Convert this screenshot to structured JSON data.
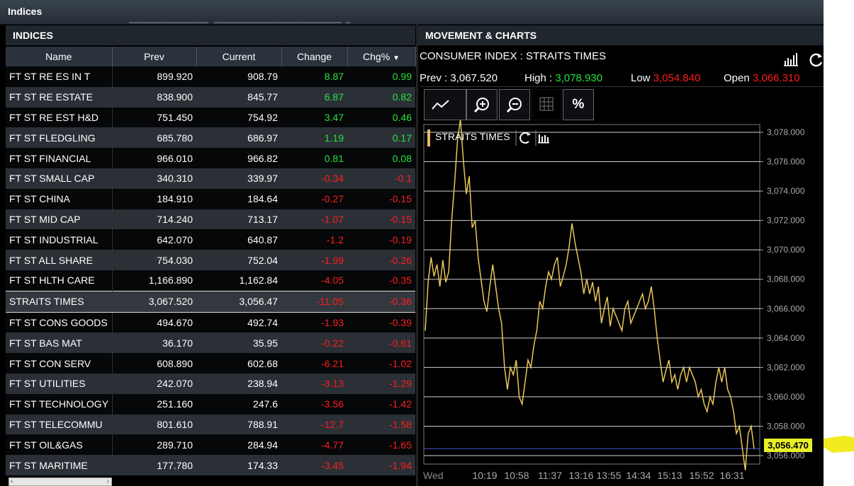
{
  "window": {
    "title": "Indices"
  },
  "left_panel": {
    "title": "INDICES",
    "columns": [
      "Name",
      "Prev",
      "Current",
      "Change",
      "Chg%"
    ],
    "rows": [
      {
        "name": "FT ST RE ES IN T",
        "prev": "899.920",
        "current": "908.79",
        "change": "8.87",
        "chg": "0.99",
        "dir": "pos"
      },
      {
        "name": "FT ST RE ESTATE",
        "prev": "838.900",
        "current": "845.77",
        "change": "6.87",
        "chg": "0.82",
        "dir": "pos"
      },
      {
        "name": "FT ST RE EST H&D",
        "prev": "751.450",
        "current": "754.92",
        "change": "3.47",
        "chg": "0.46",
        "dir": "pos"
      },
      {
        "name": "FT ST FLEDGLING",
        "prev": "685.780",
        "current": "686.97",
        "change": "1.19",
        "chg": "0.17",
        "dir": "pos"
      },
      {
        "name": "FT ST FINANCIAL",
        "prev": "966.010",
        "current": "966.82",
        "change": "0.81",
        "chg": "0.08",
        "dir": "pos"
      },
      {
        "name": "FT ST SMALL CAP",
        "prev": "340.310",
        "current": "339.97",
        "change": "-0.34",
        "chg": "-0.1",
        "dir": "neg"
      },
      {
        "name": "FT ST CHINA",
        "prev": "184.910",
        "current": "184.64",
        "change": "-0.27",
        "chg": "-0.15",
        "dir": "neg"
      },
      {
        "name": "FT ST MID CAP",
        "prev": "714.240",
        "current": "713.17",
        "change": "-1.07",
        "chg": "-0.15",
        "dir": "neg"
      },
      {
        "name": "FT ST INDUSTRIAL",
        "prev": "642.070",
        "current": "640.87",
        "change": "-1.2",
        "chg": "-0.19",
        "dir": "neg"
      },
      {
        "name": "FT ST ALL SHARE",
        "prev": "754.030",
        "current": "752.04",
        "change": "-1.99",
        "chg": "-0.26",
        "dir": "neg"
      },
      {
        "name": "FT ST HLTH CARE",
        "prev": "1,166.890",
        "current": "1,162.84",
        "change": "-4.05",
        "chg": "-0.35",
        "dir": "neg"
      },
      {
        "name": "STRAITS TIMES",
        "prev": "3,067.520",
        "current": "3,056.47",
        "change": "-11.05",
        "chg": "-0.36",
        "dir": "neg",
        "selected": true
      },
      {
        "name": "FT ST CONS GOODS",
        "prev": "494.670",
        "current": "492.74",
        "change": "-1.93",
        "chg": "-0.39",
        "dir": "neg"
      },
      {
        "name": "FT ST BAS MAT",
        "prev": "36.170",
        "current": "35.95",
        "change": "-0.22",
        "chg": "-0.61",
        "dir": "neg"
      },
      {
        "name": "FT ST CON SERV",
        "prev": "608.890",
        "current": "602.68",
        "change": "-6.21",
        "chg": "-1.02",
        "dir": "neg"
      },
      {
        "name": "FT ST UTILITIES",
        "prev": "242.070",
        "current": "238.94",
        "change": "-3.13",
        "chg": "-1.29",
        "dir": "neg"
      },
      {
        "name": "FT ST TECHNOLOGY",
        "prev": "251.160",
        "current": "247.6",
        "change": "-3.56",
        "chg": "-1.42",
        "dir": "neg"
      },
      {
        "name": "FT ST TELECOMMU",
        "prev": "801.610",
        "current": "788.91",
        "change": "-12.7",
        "chg": "-1.58",
        "dir": "neg"
      },
      {
        "name": "FT ST OIL&GAS",
        "prev": "289.710",
        "current": "284.94",
        "change": "-4.77",
        "chg": "-1.65",
        "dir": "neg"
      },
      {
        "name": "FT ST MARITIME",
        "prev": "177.780",
        "current": "174.33",
        "change": "-3.45",
        "chg": "-1.94",
        "dir": "neg"
      }
    ]
  },
  "right_panel": {
    "title": "MOVEMENT & CHARTS",
    "chart_title": "CONSUMER INDEX : STRAITS TIMES",
    "stats": {
      "prev_label": "Prev :",
      "prev_value": "3,067.520",
      "high_label": "High :",
      "high_value": "3,078.930",
      "low_label": "Low",
      "low_value": "3,054.840",
      "open_label": "Open",
      "open_value": "3,066.310"
    },
    "tools": {
      "zoom_in": "zoom-in",
      "zoom_out": "zoom-out",
      "percent_label": "%"
    },
    "legend_label": "STRAITS TIMES",
    "current_price": "3,056.470",
    "x_start_label": "Wed",
    "colors": {
      "line": "#e8c85a",
      "positive": "#27e23b",
      "negative": "#ff1c1c",
      "price_tag": "#e7ef28"
    }
  },
  "chart_data": {
    "type": "line",
    "series": [
      {
        "name": "STRAITS TIMES",
        "values": [
          3064.5,
          3067.8,
          3069.5,
          3068.2,
          3069.0,
          3067.5,
          3069.3,
          3067.8,
          3068.5,
          3072.0,
          3074.5,
          3077.5,
          3078.9,
          3076.0,
          3073.8,
          3075.0,
          3071.5,
          3072.0,
          3069.5,
          3068.0,
          3066.5,
          3065.8,
          3067.5,
          3069.0,
          3067.5,
          3066.0,
          3065.0,
          3062.0,
          3060.5,
          3062.0,
          3061.5,
          3062.5,
          3060.0,
          3059.5,
          3061.0,
          3062.5,
          3062.0,
          3063.5,
          3064.5,
          3066.5,
          3066.0,
          3067.5,
          3068.5,
          3068.0,
          3069.0,
          3069.5,
          3067.5,
          3068.2,
          3069.0,
          3070.2,
          3071.8,
          3070.5,
          3069.5,
          3068.5,
          3067.0,
          3068.0,
          3067.0,
          3067.8,
          3066.5,
          3067.5,
          3065.0,
          3066.0,
          3066.8,
          3064.8,
          3066.0,
          3065.5,
          3065.0,
          3064.5,
          3066.0,
          3066.5,
          3065.0,
          3065.5,
          3066.0,
          3066.5,
          3067.0,
          3066.0,
          3066.5,
          3067.5,
          3066.0,
          3064.0,
          3062.5,
          3061.0,
          3061.8,
          3062.5,
          3061.0,
          3061.5,
          3060.5,
          3061.5,
          3062.0,
          3061.0,
          3062.0,
          3061.5,
          3061.0,
          3060.0,
          3060.5,
          3059.5,
          3059.0,
          3060.0,
          3059.5,
          3061.0,
          3062.0,
          3061.0,
          3062.0,
          3060.5,
          3060.0,
          3059.0,
          3057.5,
          3058.0,
          3056.5,
          3055.0,
          3057.5,
          3058.0,
          3056.47
        ]
      }
    ],
    "x_labels": [
      "10:19",
      "10:58",
      "11:37",
      "13:16",
      "13:55",
      "14:34",
      "15:13",
      "15:52",
      "16:31"
    ],
    "y_ticks": [
      3078.0,
      3076.0,
      3074.0,
      3072.0,
      3070.0,
      3068.0,
      3066.0,
      3064.0,
      3062.0,
      3060.0,
      3058.0,
      3056.0
    ],
    "y_tick_labels": [
      "3,078.000",
      "3,076.000",
      "3,074.000",
      "3,072.000",
      "3,070.000",
      "3,068.000",
      "3,066.000",
      "3,064.000",
      "3,062.000",
      "3,060.000",
      "3,058.000",
      "3,056.000"
    ],
    "ylim": [
      3054.8,
      3078.9
    ],
    "grid": true,
    "legend": "top-left"
  }
}
